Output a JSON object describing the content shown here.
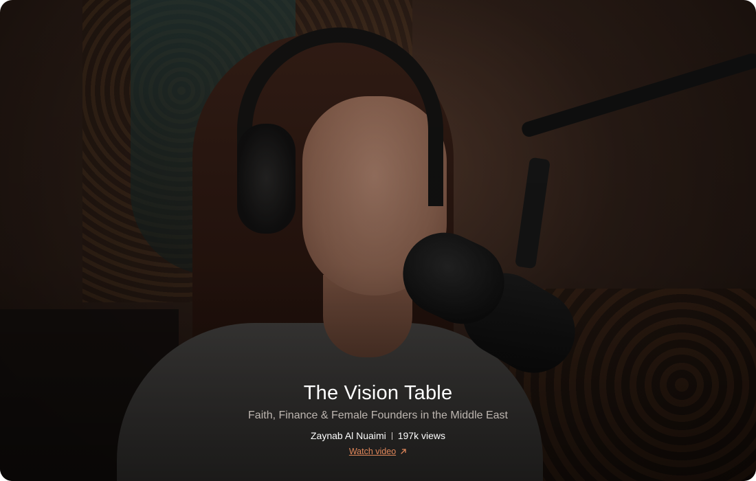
{
  "card": {
    "title": "The Vision Table",
    "subtitle": "Faith, Finance & Female Founders in the Middle East",
    "author": "Zaynab Al Nuaimi",
    "views": "197k views",
    "cta_label": "Watch video",
    "cta_icon": "arrow-up-right-icon",
    "accent_color": "#e0875a"
  }
}
